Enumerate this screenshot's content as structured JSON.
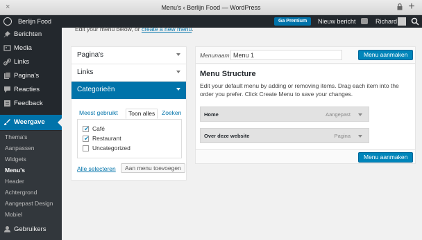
{
  "browser": {
    "title": "Menu's ‹ Berlijn Food — WordPress",
    "close_glyph": "×",
    "new_tab_glyph": "+"
  },
  "adminbar": {
    "site_name": "Berlijn Food",
    "premium_label": "Ga Premium",
    "new_post_label": "Nieuw bericht",
    "user_name": "Richard"
  },
  "sidebar": {
    "items": [
      {
        "label": "Berichten",
        "icon": "pin-icon"
      },
      {
        "label": "Media",
        "icon": "media-icon"
      },
      {
        "label": "Links",
        "icon": "link-icon"
      },
      {
        "label": "Pagina's",
        "icon": "pages-icon"
      },
      {
        "label": "Reacties",
        "icon": "comment-icon"
      },
      {
        "label": "Feedback",
        "icon": "feedback-icon"
      },
      {
        "label": "Weergave",
        "icon": "appearance-icon"
      }
    ],
    "submenu": [
      "Thema's",
      "Aanpassen",
      "Widgets",
      "Menu's",
      "Header",
      "Achtergrond",
      "Aangepast Design",
      "Mobiel"
    ],
    "bottom_item": {
      "label": "Gebruikers",
      "icon": "users-icon"
    }
  },
  "main": {
    "intro_text": "Edit your menu below, or",
    "intro_link": "create a new menu",
    "intro_tail": "."
  },
  "accordion": {
    "sections": [
      "Pagina's",
      "Links",
      "Categorieën"
    ],
    "tabs": [
      "Meest gebruikt",
      "Toon alles",
      "Zoeken"
    ],
    "categories": [
      {
        "label": "Café",
        "checked": true
      },
      {
        "label": "Restaurant",
        "checked": true
      },
      {
        "label": "Uncategorized",
        "checked": false
      }
    ],
    "select_all": "Alle selecteren",
    "add_button": "Aan menu toevoegen"
  },
  "menu_panel": {
    "name_label": "Menunaam",
    "name_value": "Menu 1",
    "create_button": "Menu aanmaken",
    "heading": "Menu Structure",
    "description": "Edit your default menu by adding or removing items. Drag each item into the order you prefer. Click Create Menu to save your changes.",
    "items": [
      {
        "name": "Home",
        "type": "Aangepast"
      },
      {
        "name": "Over deze website",
        "type": "Pagina"
      }
    ]
  },
  "colors": {
    "admin_dark": "#23282d",
    "accent_blue": "#0073aa",
    "button_blue": "#0085ba"
  }
}
